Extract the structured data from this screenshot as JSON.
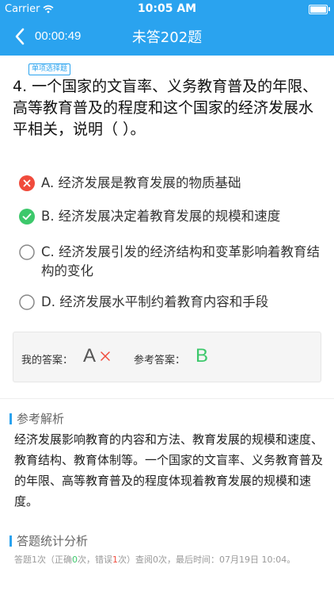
{
  "status_bar": {
    "carrier": "Carrier",
    "time": "10:05 AM"
  },
  "nav": {
    "timer": "00:00:49",
    "title": "未答202题"
  },
  "question": {
    "type_badge": "单项选择题",
    "text": "4. 一个国家的文盲率、义务教育普及的年限、高等教育普及的程度和这个国家的经济发展水平相关，说明（    ）。",
    "options": [
      {
        "letter": "A",
        "text": "A. 经济发展是教育发展的物质基础",
        "state": "wrong",
        "icon": "wrong-icon"
      },
      {
        "letter": "B",
        "text": "B. 经济发展决定着教育发展的规模和速度",
        "state": "correct",
        "icon": "correct-icon"
      },
      {
        "letter": "C",
        "text": "C. 经济发展引发的经济结构和变革影响着教育结构的变化",
        "state": "none",
        "icon": "radio-empty-icon"
      },
      {
        "letter": "D",
        "text": "D. 经济发展水平制约着教育内容和手段",
        "state": "none",
        "icon": "radio-empty-icon"
      }
    ]
  },
  "answer": {
    "my_label": "我的答案：",
    "my_value": "A",
    "ref_label": "参考答案：",
    "ref_value": "B"
  },
  "analysis": {
    "title": "参考解析",
    "text": "经济发展影响教育的内容和方法、教育发展的规模和速度、教育结构、教育体制等。一个国家的文盲率、义务教育普及的年限、高等教育普及的程度体现着教育发展的规模和速度。"
  },
  "statistics": {
    "title": "答题统计分析",
    "prefix": "答题1次（正确",
    "correct_count": "0",
    "mid": "次，错误",
    "wrong_count": "1",
    "suffix": "次）查阅0次，最后时间：07月19日 10:04。"
  },
  "colors": {
    "primary": "#2aa3ef",
    "correct": "#3cc86b",
    "wrong": "#f04b3c"
  }
}
